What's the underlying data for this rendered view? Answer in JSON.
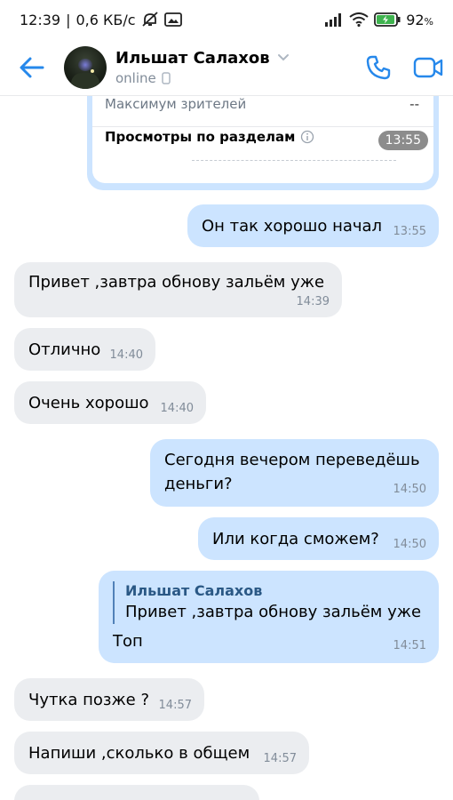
{
  "status_bar": {
    "time": "12:39",
    "speed": "0,6 КБ/с",
    "battery": "92",
    "icons": [
      "mute-icon",
      "gallery-icon",
      "signal-icon",
      "wifi-icon",
      "battery-icon"
    ]
  },
  "header": {
    "name": "Ильшат Салахов",
    "status": "online",
    "icons": [
      "back-arrow-icon",
      "chevron-down-icon",
      "phone-device-icon",
      "call-icon",
      "video-call-icon"
    ]
  },
  "forward_card": {
    "row1_label": "Максимум зрителей",
    "row1_value": "--",
    "row2_label": "Просмотры по разделам",
    "time": "13:55"
  },
  "messages": [
    {
      "dir": "out",
      "text": "Он так хорошо начал",
      "time": "13:55"
    },
    {
      "dir": "in",
      "text": "Привет ,завтра обнову зальём уже",
      "time": "14:39"
    },
    {
      "dir": "in",
      "text": "Отлично",
      "time": "14:40"
    },
    {
      "dir": "in",
      "text": "Очень хорошо",
      "time": "14:40"
    },
    {
      "dir": "out",
      "text": "Сегодня вечером переведёшь деньги?",
      "time": "14:50"
    },
    {
      "dir": "out",
      "text": "Или когда сможем?",
      "time": "14:50"
    },
    {
      "dir": "out",
      "reply_author": "Ильшат Салахов",
      "reply_text": "Привет ,завтра обнову зальём уже",
      "text": "Топ",
      "time": "14:51"
    },
    {
      "dir": "in",
      "text": "Чутка позже ?",
      "time": "14:57"
    },
    {
      "dir": "in",
      "text": "Напиши ,сколько в общем",
      "time": "14:57"
    }
  ],
  "colors": {
    "accent": "#2688eb",
    "incoming_bubble": "#ebedf0",
    "outgoing_bubble": "#cce4ff",
    "secondary_text": "#818c99"
  }
}
